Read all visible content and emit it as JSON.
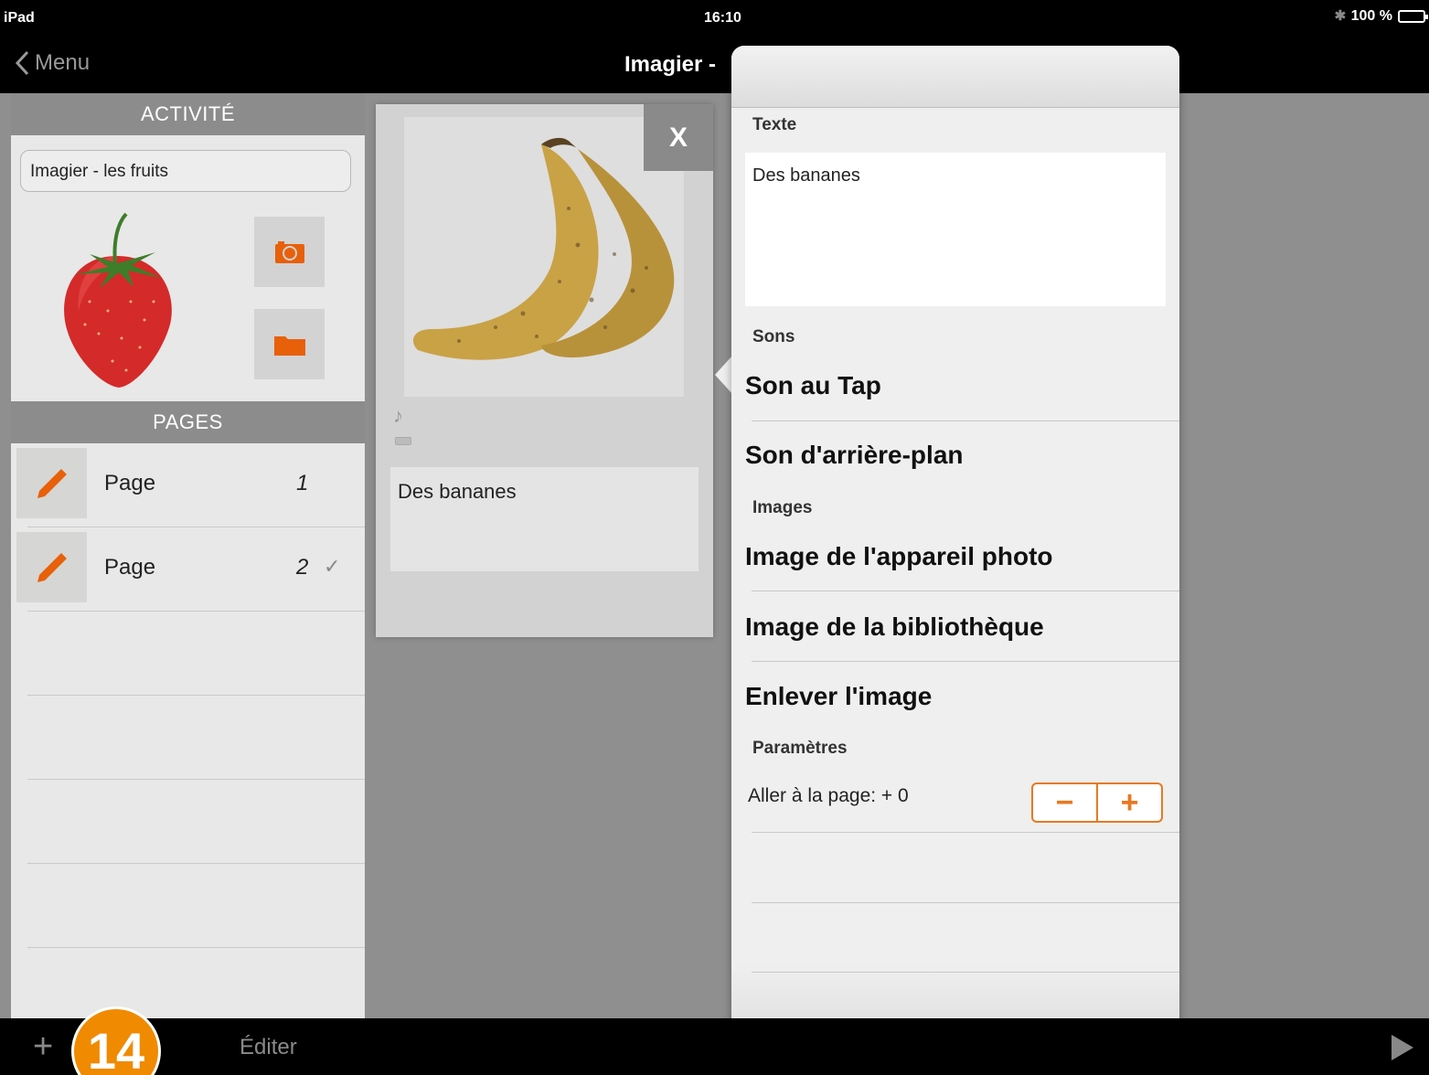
{
  "statusbar": {
    "device": "iPad",
    "time": "16:10",
    "battery": "100 %"
  },
  "navbar": {
    "back_label": "Menu",
    "title": "Imagier - "
  },
  "left": {
    "activity_header": "ACTIVITÉ",
    "activity_name": "Imagier - les fruits",
    "pages_header": "PAGES",
    "pages": [
      {
        "label": "Page",
        "number": "1",
        "checked": ""
      },
      {
        "label": "Page",
        "number": "2",
        "checked": "✓"
      }
    ]
  },
  "card": {
    "close_label": "X",
    "caption": "Des bananes",
    "note_icon": "♪"
  },
  "popover": {
    "texte_title": "Texte",
    "texte_value": "Des bananes",
    "sons_title": "Sons",
    "son_tap": "Son au Tap",
    "son_arriere": "Son d'arrière-plan",
    "images_title": "Images",
    "image_appareil": "Image de l'appareil photo",
    "image_biblio": "Image de la bibliothèque",
    "enlever_image": "Enlever l'image",
    "params_title": "Paramètres",
    "aller_page": "Aller à la page: + 0",
    "minus": "−",
    "plus": "+"
  },
  "toolbar": {
    "add": "+",
    "edit_label": "Éditer",
    "badge": "14"
  },
  "colors": {
    "accent": "#e8791e",
    "badge": "#f08a00",
    "background_gray": "#8f8f8f"
  }
}
